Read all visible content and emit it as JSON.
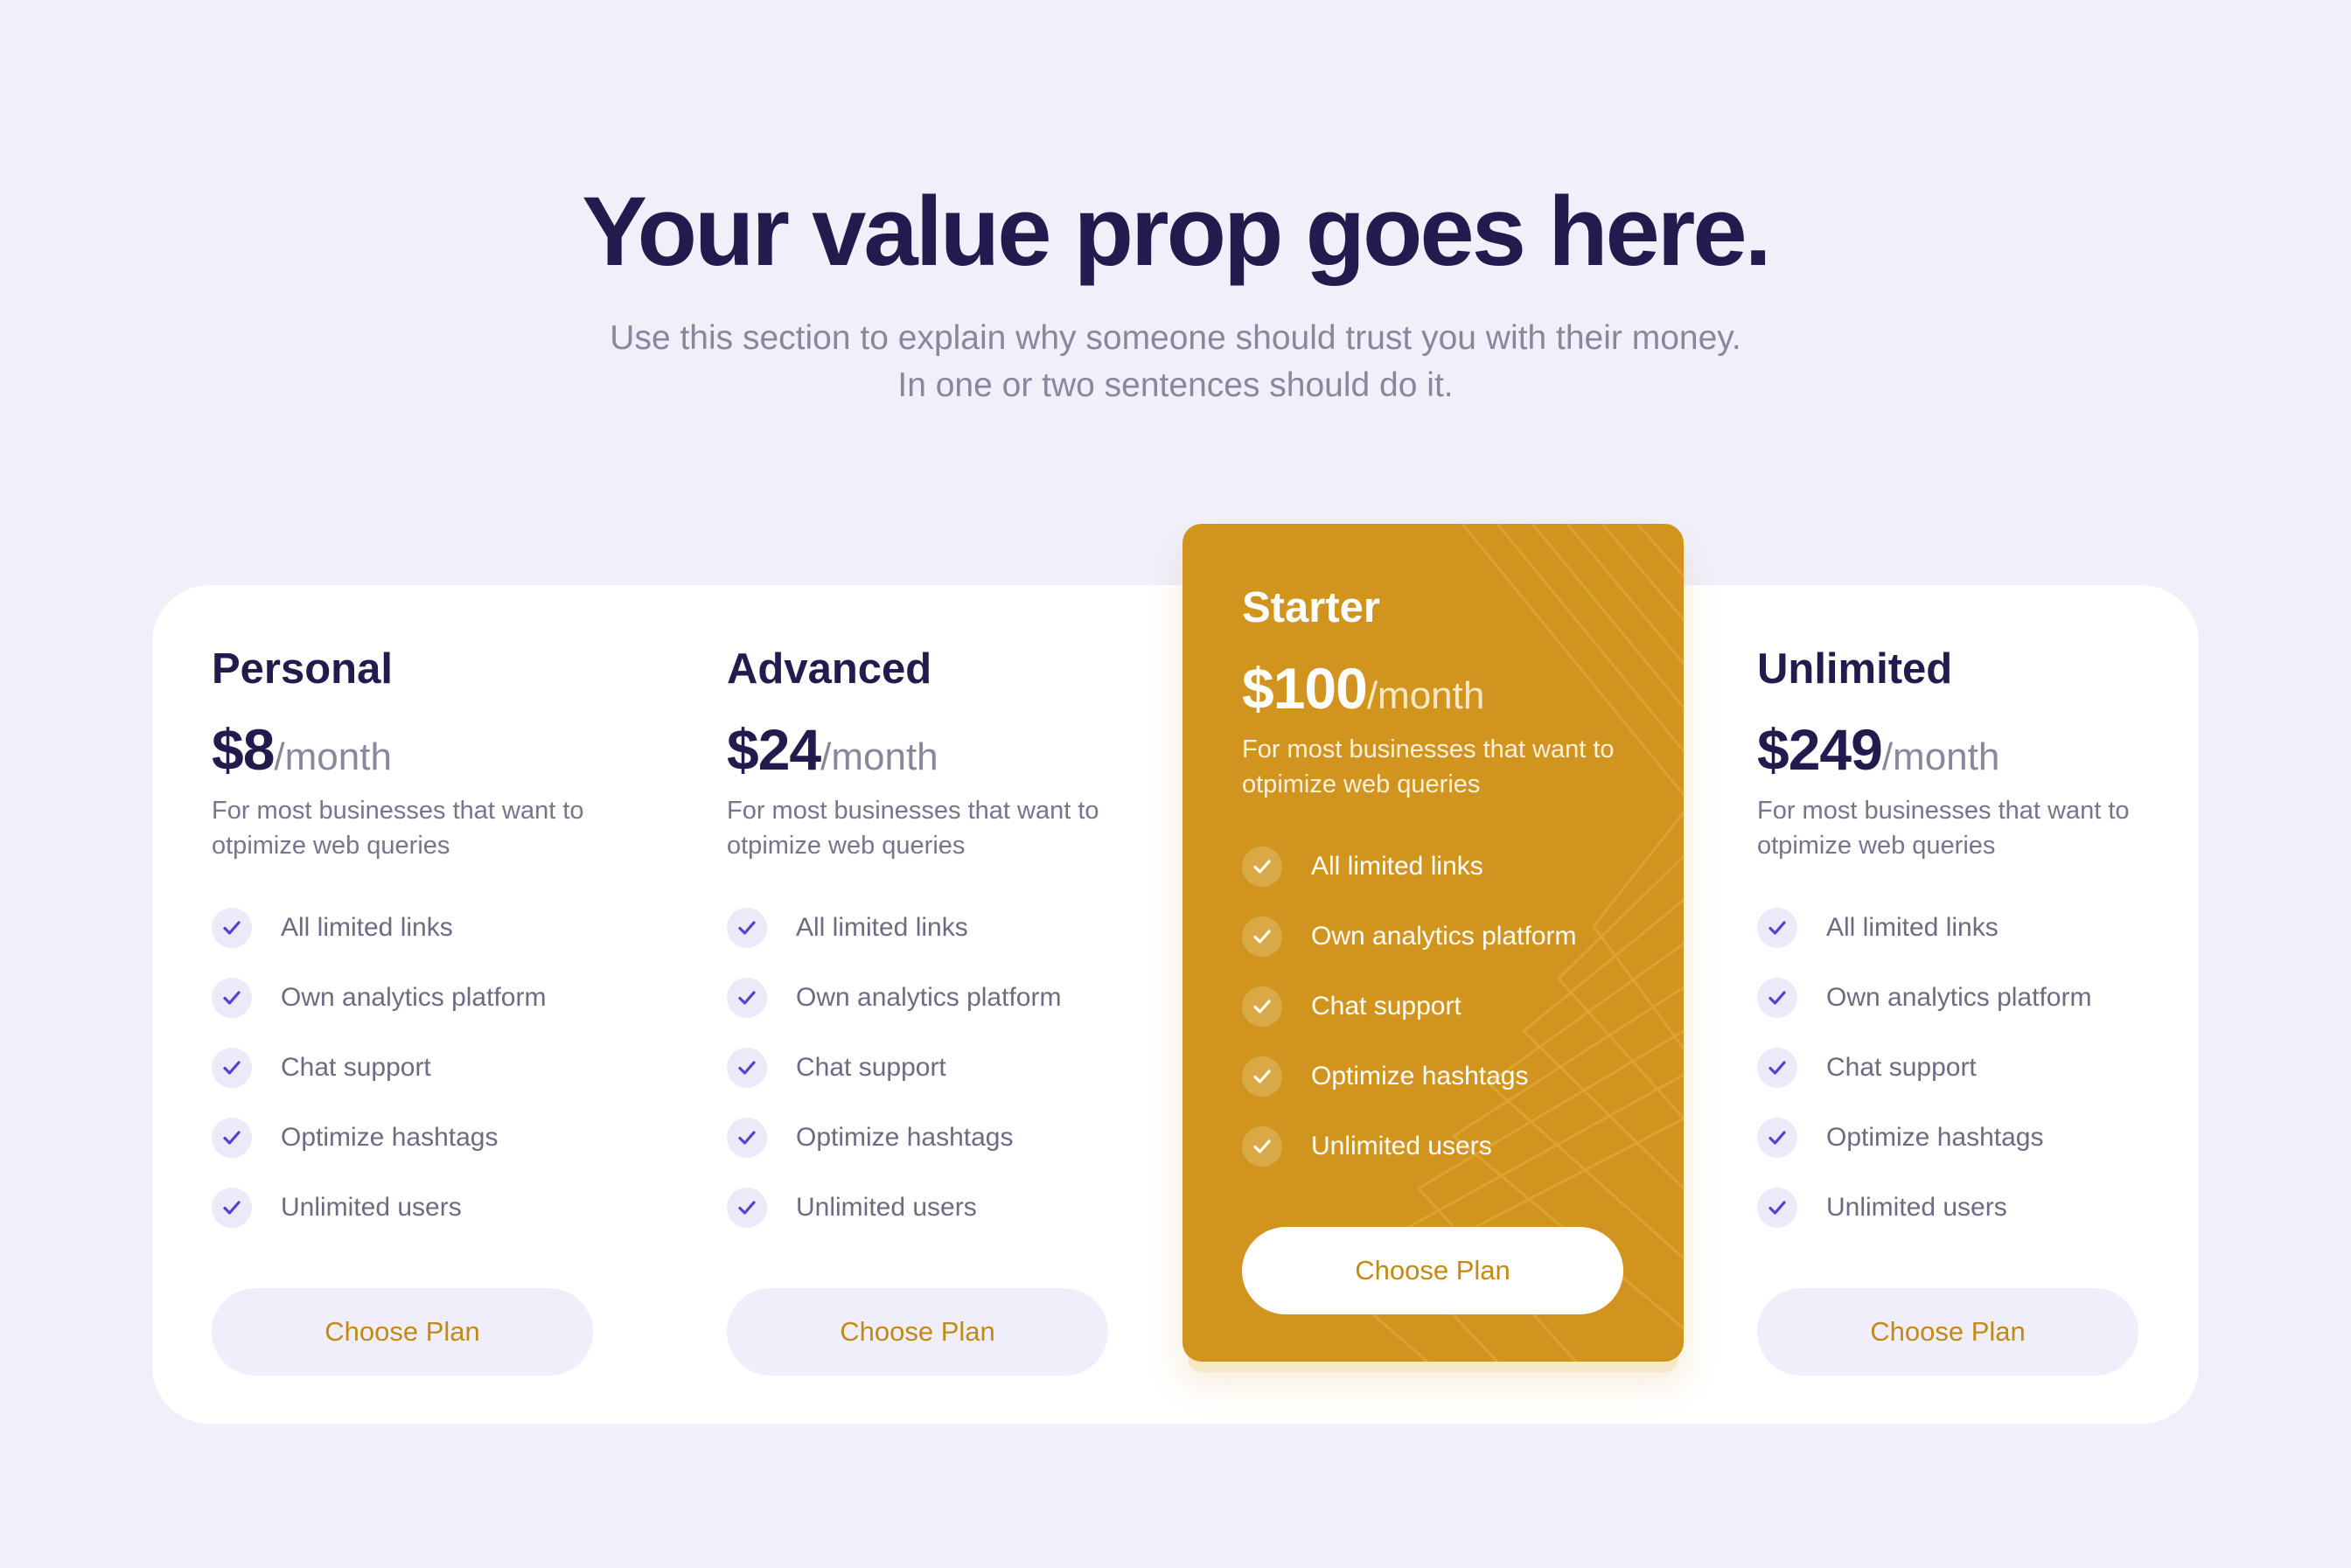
{
  "hero": {
    "title": "Your value prop goes here.",
    "subtitle_line1": "Use this section to explain why someone should trust you with their money.",
    "subtitle_line2": "In one or two sentences should do it."
  },
  "colors": {
    "background": "#f0f0fb",
    "heading": "#221c4e",
    "accent": "#d1951f",
    "check": "#5b3fd1",
    "button_text": "#c28a14"
  },
  "plans": [
    {
      "name": "Personal",
      "price": "$8",
      "period": "/month",
      "description": "For most businesses that want to otpimize web queries",
      "features": [
        "All limited links",
        "Own analytics platform",
        "Chat support",
        "Optimize hashtags",
        "Unlimited users"
      ],
      "button": "Choose Plan",
      "featured": false
    },
    {
      "name": "Advanced",
      "price": "$24",
      "period": "/month",
      "description": "For most businesses that want to otpimize web queries",
      "features": [
        "All limited links",
        "Own analytics platform",
        "Chat support",
        "Optimize hashtags",
        "Unlimited users"
      ],
      "button": "Choose Plan",
      "featured": false
    },
    {
      "name": "Starter",
      "price": "$100",
      "period": "/month",
      "description": "For most businesses that want to otpimize web queries",
      "features": [
        "All limited links",
        "Own analytics platform",
        "Chat support",
        "Optimize hashtags",
        "Unlimited users"
      ],
      "button": "Choose Plan",
      "featured": true
    },
    {
      "name": "Unlimited",
      "price": "$249",
      "period": "/month",
      "description": "For most businesses that want to otpimize web queries",
      "features": [
        "All limited links",
        "Own analytics platform",
        "Chat support",
        "Optimize hashtags",
        "Unlimited users"
      ],
      "button": "Choose Plan",
      "featured": false
    }
  ]
}
